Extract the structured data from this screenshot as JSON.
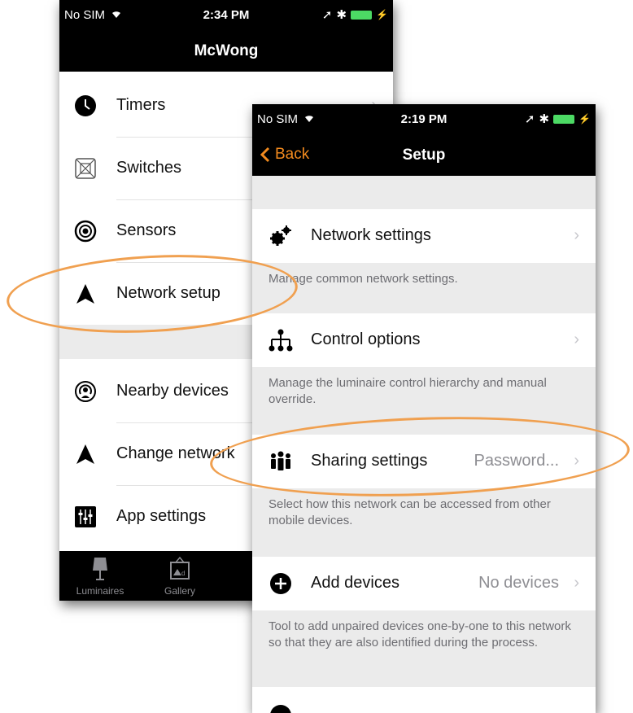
{
  "back_phone": {
    "status": {
      "carrier": "No SIM",
      "time": "2:34 PM"
    },
    "title": "McWong",
    "items": [
      {
        "label": "Timers",
        "icon": "clock-icon"
      },
      {
        "label": "Switches",
        "icon": "switch-icon"
      },
      {
        "label": "Sensors",
        "icon": "sensor-icon"
      },
      {
        "label": "Network setup",
        "icon": "network-arrow-icon"
      },
      {
        "label": "Nearby devices",
        "icon": "nearby-icon"
      },
      {
        "label": "Change network",
        "icon": "network-arrow-icon"
      },
      {
        "label": "App settings",
        "icon": "sliders-icon"
      }
    ],
    "tabs": [
      {
        "label": "Luminaires",
        "icon": "lamp-icon"
      },
      {
        "label": "Gallery",
        "icon": "gallery-icon"
      }
    ]
  },
  "front_phone": {
    "status": {
      "carrier": "No SIM",
      "time": "2:19 PM"
    },
    "back_label": "Back",
    "title": "Setup",
    "rows": [
      {
        "label": "Network settings",
        "value": "",
        "icon": "gears-icon",
        "description": "Manage common network settings."
      },
      {
        "label": "Control options",
        "value": "",
        "icon": "hierarchy-icon",
        "description": "Manage the luminaire control hierarchy and manual override."
      },
      {
        "label": "Sharing settings",
        "value": "Password...",
        "icon": "people-icon",
        "description": "Select how this network can be accessed from other mobile devices."
      },
      {
        "label": "Add devices",
        "value": "No devices",
        "icon": "plus-circle-icon",
        "description": "Tool to add unpaired devices one-by-one to this network so that they are also identified during the process."
      }
    ]
  },
  "colors": {
    "accent": "#f28a1e",
    "highlight": "#f0a050",
    "separator_bg": "#ebebeb"
  }
}
